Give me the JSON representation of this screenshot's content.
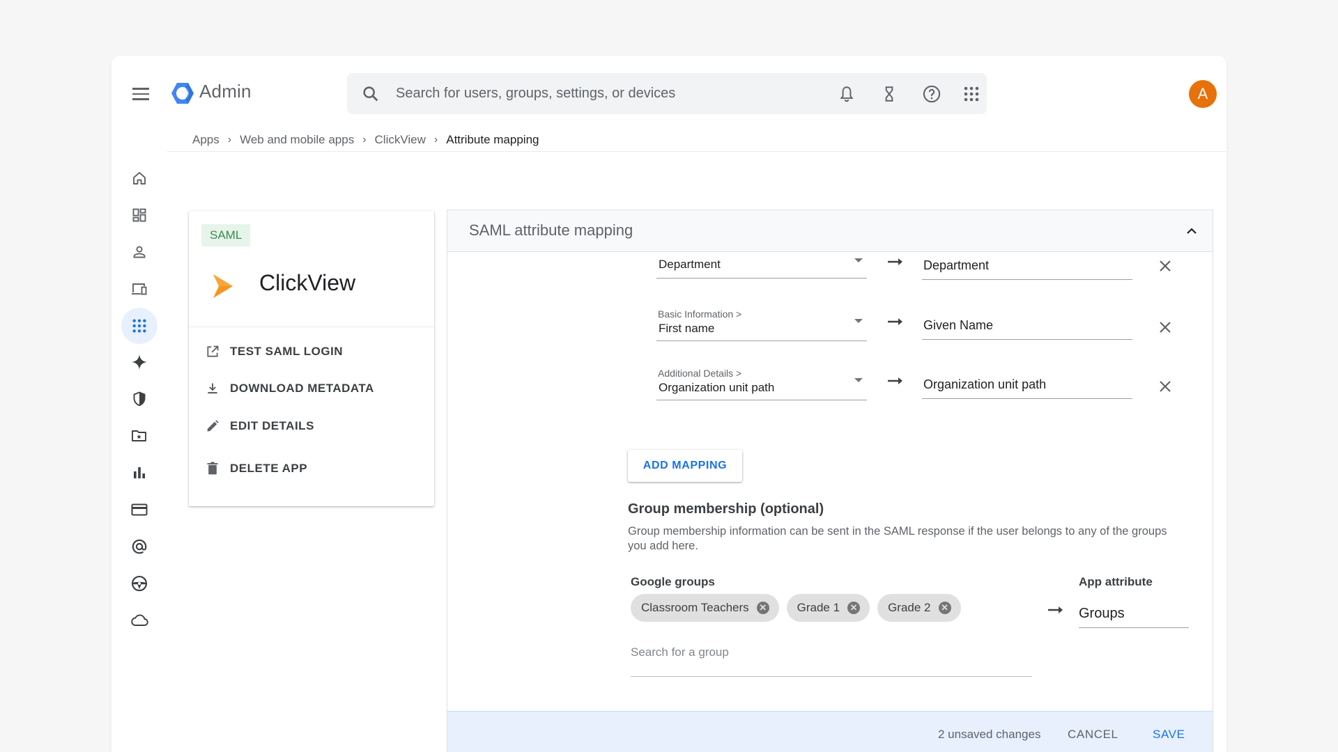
{
  "header": {
    "app_title": "Admin",
    "search_placeholder": "Search for users, groups, settings, or devices",
    "avatar_initial": "A"
  },
  "breadcrumb": [
    "Apps",
    "Web and mobile apps",
    "ClickView",
    "Attribute mapping"
  ],
  "colors": {
    "accent": "#1a73e8",
    "avatar_bg": "#e8710a",
    "app_logo": "#f7941d"
  },
  "rail_icons": [
    "home-icon",
    "dashboard-icon",
    "person-icon",
    "devices-icon",
    "apps-grid-icon",
    "sparkle-icon",
    "security-shield-icon",
    "folder-icon",
    "reporting-icon",
    "billing-icon",
    "account-at-icon",
    "rules-icon",
    "storage-cloud-icon"
  ],
  "app_card": {
    "badge": "SAML",
    "name": "ClickView",
    "actions": [
      {
        "label": "TEST SAML LOGIN",
        "icon": "open-in-new-icon"
      },
      {
        "label": "DOWNLOAD METADATA",
        "icon": "download-icon"
      },
      {
        "label": "EDIT DETAILS",
        "icon": "pencil-icon"
      },
      {
        "label": "DELETE APP",
        "icon": "trash-icon"
      }
    ]
  },
  "panel": {
    "title": "SAML attribute mapping",
    "mappings": [
      {
        "category": "",
        "source": "Department",
        "target": "Department"
      },
      {
        "category": "Basic Information >",
        "source": "First name",
        "target": "Given Name"
      },
      {
        "category": "Additional Details >",
        "source": "Organization unit path",
        "target": "Organization unit path"
      }
    ],
    "add_mapping_label": "ADD MAPPING",
    "group_membership": {
      "title": "Group membership (optional)",
      "description": "Group membership information can be sent in the SAML response if the user belongs to any of the groups you add here.",
      "google_groups_label": "Google groups",
      "chips": [
        "Classroom Teachers",
        "Grade 1",
        "Grade 2"
      ],
      "search_placeholder": "Search for a group",
      "app_attribute_label": "App attribute",
      "app_attribute_value": "Groups"
    }
  },
  "savebar": {
    "unsaved_text": "2 unsaved changes",
    "cancel_label": "CANCEL",
    "save_label": "SAVE"
  }
}
